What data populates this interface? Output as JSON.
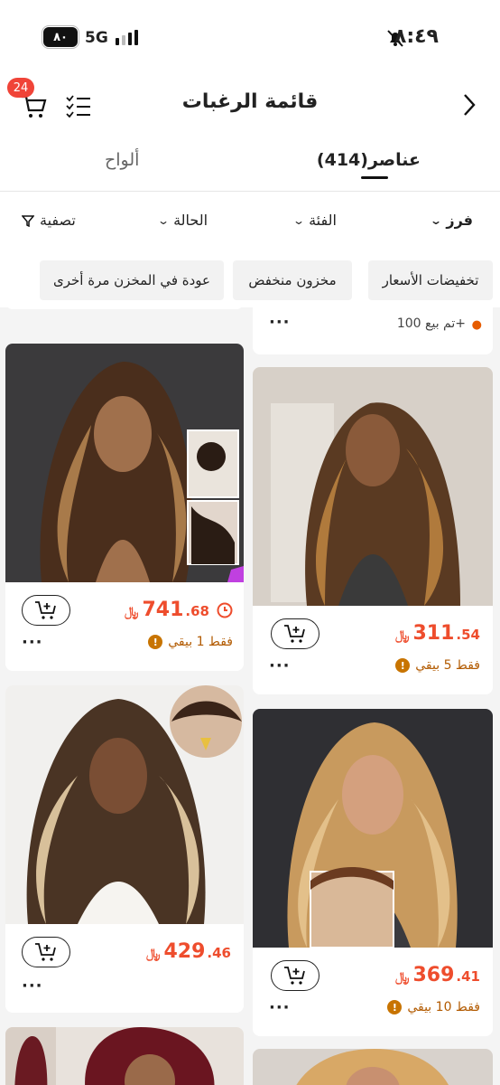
{
  "status_bar": {
    "battery": "٨٠",
    "network": "5G",
    "time": "٨:٤٩"
  },
  "header": {
    "title": "قائمة الرغبات",
    "cart_count": "24"
  },
  "tabs": [
    {
      "label": "عناصر(414)",
      "active": true
    },
    {
      "label": "ألواح",
      "active": false
    }
  ],
  "filters": {
    "sort": "فرز",
    "category": "الفئة",
    "state": "الحالة",
    "filter": "تصفية"
  },
  "chips": [
    "تخفيضات الأسعار",
    "مخزون منخفض",
    "عودة في المخزن مرة أخرى"
  ],
  "partial_top": {
    "sold": "تم بيع 100+"
  },
  "products": [
    {
      "price_int": "311",
      "price_dec": ".54",
      "currency": "﷼",
      "stock": "فقط 5 بيقي"
    },
    {
      "price_int": "741",
      "price_dec": ".68",
      "currency": "﷼",
      "stock": "فقط 1 بيقي"
    },
    {
      "price_int": "369",
      "price_dec": ".41",
      "currency": "﷼",
      "stock": "فقط 10 بيقي"
    },
    {
      "price_int": "429",
      "price_dec": ".46",
      "currency": "﷼",
      "stock": ""
    }
  ],
  "colors": {
    "accent": "#ee4d2d",
    "badge": "#f04438",
    "warning": "#c87400"
  }
}
